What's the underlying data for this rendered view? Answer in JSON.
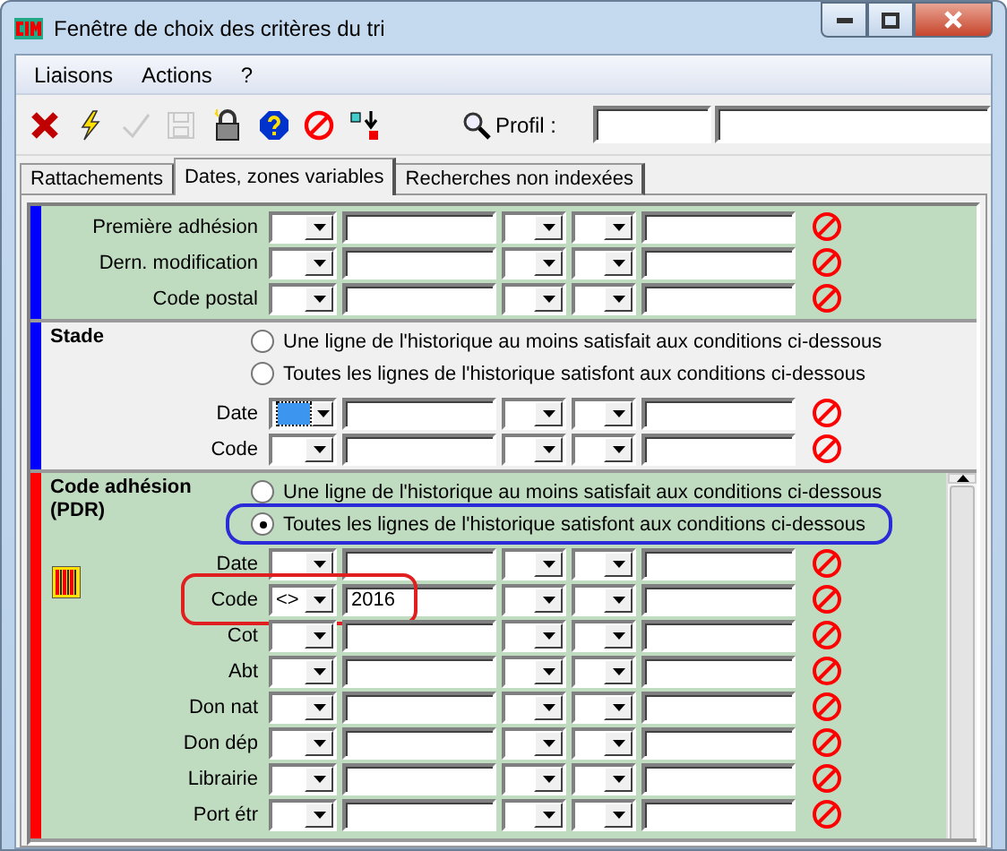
{
  "window": {
    "title": "Fenêtre de choix des critères du tri"
  },
  "menu": [
    "Liaisons",
    "Actions",
    "?"
  ],
  "toolbar": {
    "buttons": [
      {
        "kind": "cancel",
        "disabled": false
      },
      {
        "kind": "run",
        "disabled": false
      },
      {
        "kind": "validate",
        "disabled": true
      },
      {
        "kind": "save",
        "disabled": true
      },
      {
        "kind": "lock",
        "disabled": false
      },
      {
        "kind": "help",
        "disabled": false
      },
      {
        "kind": "clear",
        "disabled": false
      },
      {
        "kind": "swap",
        "disabled": false
      }
    ],
    "profile_label": "Profil :"
  },
  "tabs": [
    {
      "label": "Rattachements",
      "selected": false
    },
    {
      "label": "Dates, zones variables",
      "selected": true
    },
    {
      "label": "Recherches non indexées",
      "selected": false
    }
  ],
  "sections": [
    {
      "color": "#0000ff",
      "tinted": true,
      "rows": [
        {
          "label": "Première adhésion"
        },
        {
          "label": "Dern. modification"
        },
        {
          "label": "Code postal"
        }
      ]
    },
    {
      "color": "#0000ff",
      "tinted": false,
      "title": "Stade",
      "options": [
        {
          "label": "Une ligne de l'historique au moins satisfait aux conditions ci-dessous",
          "selected": false,
          "annotated": false
        },
        {
          "label": "Toutes les lignes de l'historique satisfont aux conditions ci-dessous",
          "selected": false,
          "annotated": false
        }
      ],
      "rows": [
        {
          "label": "Date",
          "focused": true
        },
        {
          "label": "Code"
        }
      ]
    },
    {
      "color": "#ff0000",
      "tinted": true,
      "title": "Code adhésion (PDR)",
      "scrollable": true,
      "options": [
        {
          "label": "Une ligne de l'historique au moins satisfait aux conditions ci-dessous",
          "selected": false,
          "annotated": false
        },
        {
          "label": "Toutes les lignes de l'historique satisfont aux conditions ci-dessous",
          "selected": true,
          "annotated": true
        }
      ],
      "rows": [
        {
          "label": "Date"
        },
        {
          "label": "Code",
          "operator": "<>",
          "value": "2016",
          "annotated": true
        },
        {
          "label": "Cot"
        },
        {
          "label": "Abt"
        },
        {
          "label": "Don nat"
        },
        {
          "label": "Don dép"
        },
        {
          "label": "Librairie"
        },
        {
          "label": "Port étr"
        }
      ]
    }
  ]
}
